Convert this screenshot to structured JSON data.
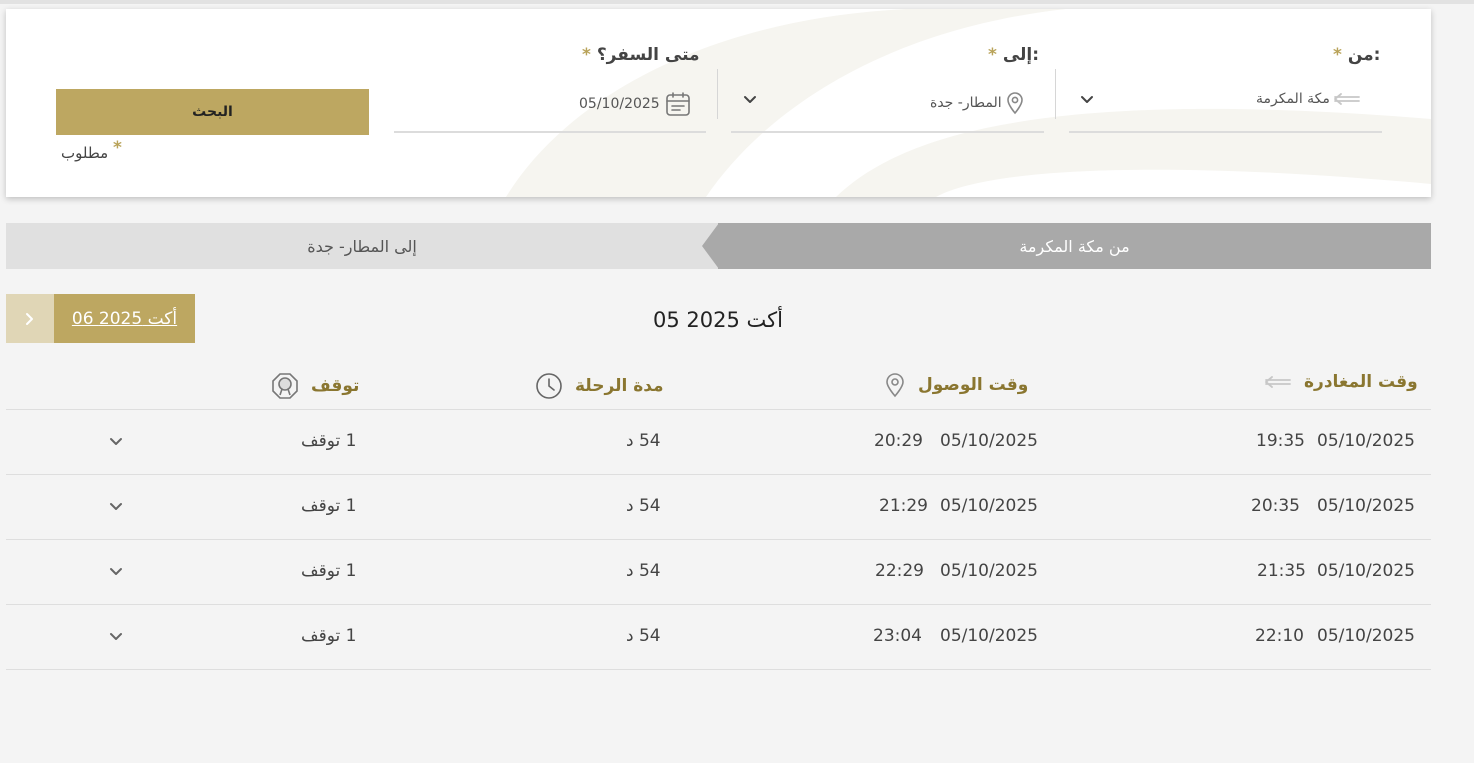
{
  "search": {
    "from_label": ":من",
    "to_label": ":إلى",
    "date_label": "متى السفر؟",
    "required_star": "*",
    "from_value": "مكة المكرمة",
    "to_value": "المطار- جدة",
    "date_value": "05/10/2025",
    "search_button": "البحث",
    "required_note": "مطلوب"
  },
  "tabs": {
    "from": "من مكة المكرمة",
    "to": "إلى المطار- جدة"
  },
  "date_nav": {
    "current": "05 أكت 2025",
    "next": "06 أكت 2025"
  },
  "table": {
    "headers": {
      "departure": "وقت المغادرة",
      "arrival": "وقت الوصول",
      "duration": "مدة الرحلة",
      "stops": "توقف"
    },
    "rows": [
      {
        "dep_date": "05/10/2025",
        "dep_time": "19:35",
        "arr_date": "05/10/2025",
        "arr_time": "20:29",
        "duration": "54 د",
        "stops": "1 توقف"
      },
      {
        "dep_date": "05/10/2025",
        "dep_time": "20:35",
        "arr_date": "05/10/2025",
        "arr_time": "21:29",
        "duration": "54 د",
        "stops": "1 توقف"
      },
      {
        "dep_date": "05/10/2025",
        "dep_time": "21:35",
        "arr_date": "05/10/2025",
        "arr_time": "22:29",
        "duration": "54 د",
        "stops": "1 توقف"
      },
      {
        "dep_date": "05/10/2025",
        "dep_time": "22:10",
        "arr_date": "05/10/2025",
        "arr_time": "23:04",
        "duration": "54 د",
        "stops": "1 توقف"
      }
    ]
  },
  "icons": {
    "from": "arrow-left-icon",
    "to": "location-pin-icon",
    "date": "calendar-icon",
    "dropdown": "chevron-down-icon",
    "duration": "clock-icon",
    "stops": "stop-icon",
    "next": "chevron-right-icon"
  },
  "colors": {
    "accent": "#bda761",
    "header_text": "#8a7630",
    "active_tab": "#a9a9a9",
    "inactive_tab": "#e0e0e0"
  }
}
